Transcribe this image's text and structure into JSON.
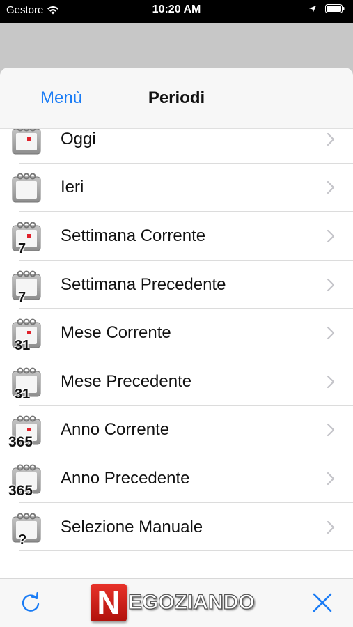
{
  "status_bar": {
    "carrier": "Gestore",
    "time": "10:20 AM",
    "wifi_icon": "wifi-icon",
    "location_icon": "location-arrow-icon",
    "battery_icon": "battery-icon"
  },
  "navbar": {
    "back_label": "Menù",
    "title": "Periodi"
  },
  "periods": [
    {
      "label": "Oggi",
      "badge": "",
      "icon": "calendar-today-icon"
    },
    {
      "label": "Ieri",
      "badge": "",
      "icon": "calendar-yesterday-icon"
    },
    {
      "label": "Settimana Corrente",
      "badge": "7",
      "icon": "calendar-week-icon"
    },
    {
      "label": "Settimana Precedente",
      "badge": "7",
      "icon": "calendar-week-icon"
    },
    {
      "label": "Mese Corrente",
      "badge": "31",
      "icon": "calendar-month-icon"
    },
    {
      "label": "Mese Precedente",
      "badge": "31",
      "icon": "calendar-month-icon"
    },
    {
      "label": "Anno Corrente",
      "badge": "365",
      "icon": "calendar-year-icon"
    },
    {
      "label": "Anno Precedente",
      "badge": "365",
      "icon": "calendar-year-icon"
    },
    {
      "label": "Selezione Manuale",
      "badge": "?",
      "icon": "calendar-manual-icon"
    }
  ],
  "toolbar": {
    "refresh_icon": "refresh-icon",
    "logo_initial": "N",
    "logo_rest": "EGOZIANDO",
    "close_icon": "close-icon"
  },
  "colors": {
    "accent": "#1a7cf5",
    "calendar_dot": "#e0212b"
  }
}
